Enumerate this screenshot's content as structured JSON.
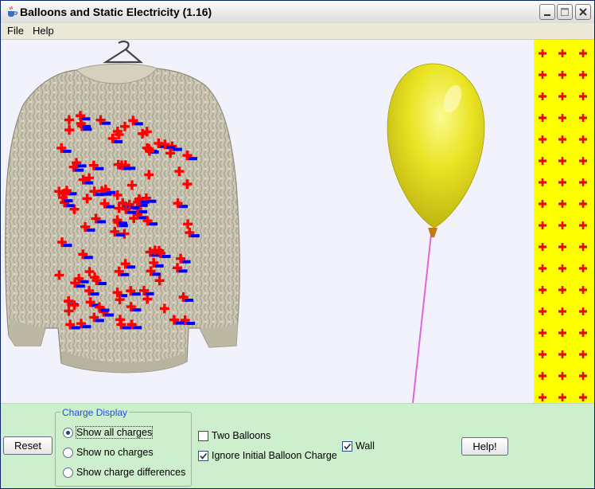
{
  "window": {
    "title": "Balloons and Static Electricity (1.16)",
    "controls": [
      "minimize",
      "maximize",
      "close"
    ]
  },
  "menu": {
    "file": "File",
    "help": "Help"
  },
  "colors": {
    "play_background": "#f2f2fc",
    "panel_background": "#cdefcd",
    "wall": "#ffff00",
    "positive_charge": "#ff0000",
    "negative_charge": "#0000ff",
    "balloon": "#e8e21f",
    "balloon_string": "#dd66dd",
    "sweater": "#c9c4b1"
  },
  "icons": [
    "java-cup-icon",
    "minimize-icon",
    "maximize-icon",
    "close-icon",
    "radio-selected-icon",
    "checkbox-check-icon"
  ],
  "controls": {
    "reset_label": "Reset",
    "help_label": "Help!",
    "charge_display": {
      "legend": "Charge Display",
      "options": [
        {
          "label": "Show all charges",
          "selected": true
        },
        {
          "label": "Show no charges",
          "selected": false
        },
        {
          "label": "Show charge differences",
          "selected": false
        }
      ]
    },
    "two_balloons": {
      "label": "Two Balloons",
      "checked": false
    },
    "ignore_initial_charge": {
      "label": "Ignore Initial Balloon Charge",
      "checked": true
    },
    "wall": {
      "label": "Wall",
      "checked": true
    }
  }
}
